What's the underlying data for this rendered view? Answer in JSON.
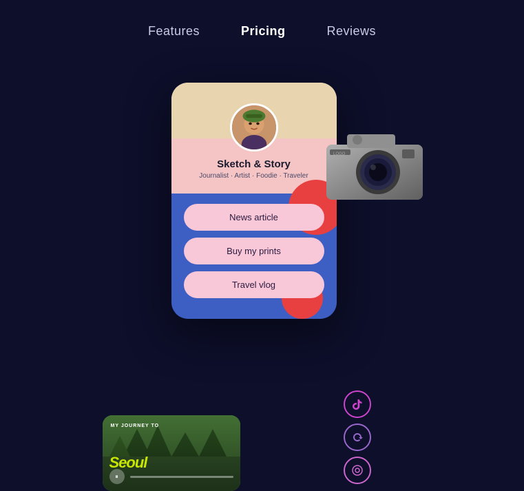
{
  "nav": {
    "items": [
      {
        "label": "Features",
        "active": false
      },
      {
        "label": "Pricing",
        "active": true
      },
      {
        "label": "Reviews",
        "active": false
      }
    ]
  },
  "profile_card": {
    "name": "Sketch & Story",
    "subtitle": "Journalist · Artist · Foodie · Traveler",
    "links": [
      {
        "label": "News article"
      },
      {
        "label": "Buy my prints"
      },
      {
        "label": "Travel vlog"
      }
    ]
  },
  "video": {
    "tag": "MY JOURNEY TO",
    "title": "Seoul",
    "play_icon": "⏸"
  },
  "social": [
    {
      "name": "tiktok",
      "icon": "♪"
    },
    {
      "name": "refresh",
      "icon": "↻"
    },
    {
      "name": "github",
      "icon": "◎"
    }
  ]
}
